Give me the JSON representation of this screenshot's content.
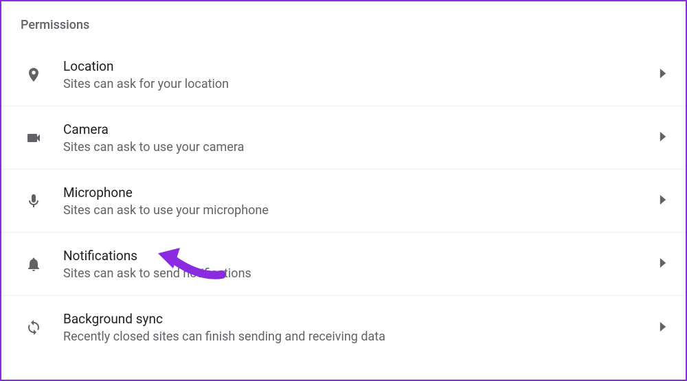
{
  "section_title": "Permissions",
  "accent_color": "#8a2be2",
  "items": [
    {
      "key": "location",
      "title": "Location",
      "desc": "Sites can ask for your location",
      "icon": "location-icon"
    },
    {
      "key": "camera",
      "title": "Camera",
      "desc": "Sites can ask to use your camera",
      "icon": "camera-icon"
    },
    {
      "key": "microphone",
      "title": "Microphone",
      "desc": "Sites can ask to use your microphone",
      "icon": "mic-icon"
    },
    {
      "key": "notifications",
      "title": "Notifications",
      "desc": "Sites can ask to send notifications",
      "icon": "bell-icon"
    },
    {
      "key": "background-sync",
      "title": "Background sync",
      "desc": "Recently closed sites can finish sending and receiving data",
      "icon": "sync-icon"
    }
  ]
}
